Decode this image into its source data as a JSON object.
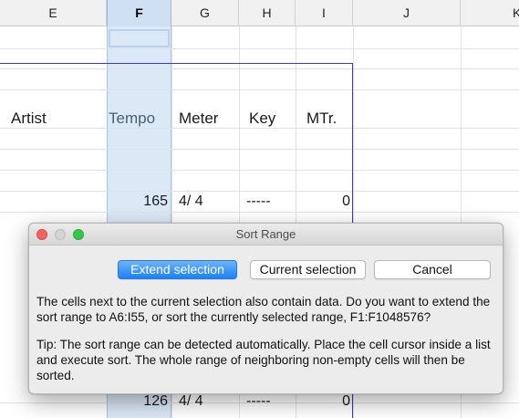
{
  "columns": [
    "E",
    "F",
    "G",
    "H",
    "I",
    "J",
    "K"
  ],
  "selected_column": "F",
  "header_row": {
    "artist": "Artist",
    "tempo": "Tempo",
    "meter": "Meter",
    "key": "Key",
    "mtr": "MTr."
  },
  "row_a": {
    "tempo": "165",
    "meter": "4/ 4",
    "key": "-----",
    "mtr": "0"
  },
  "row_b": {
    "tempo": "126",
    "meter": "4/ 4",
    "key": "-----",
    "mtr": "0"
  },
  "dialog": {
    "title": "Sort Range",
    "extend_label": "Extend selection",
    "current_label": "Current selection",
    "cancel_label": "Cancel",
    "message": "The cells next to the current selection also contain data. Do you want to extend the sort range to A6:I55, or sort the currently selected range, F1:F1048576?",
    "tip": "Tip: The sort range can be detected automatically. Place the cell cursor inside a list and execute sort. The whole range of neighboring non-empty cells will then be sorted."
  },
  "colors": {
    "range_border": "#3a3ad0",
    "selection_fill": "#cfe0f3",
    "primary_button": "#1b82f5",
    "close_light": "#fc605c",
    "zoom_light": "#34c84a"
  }
}
